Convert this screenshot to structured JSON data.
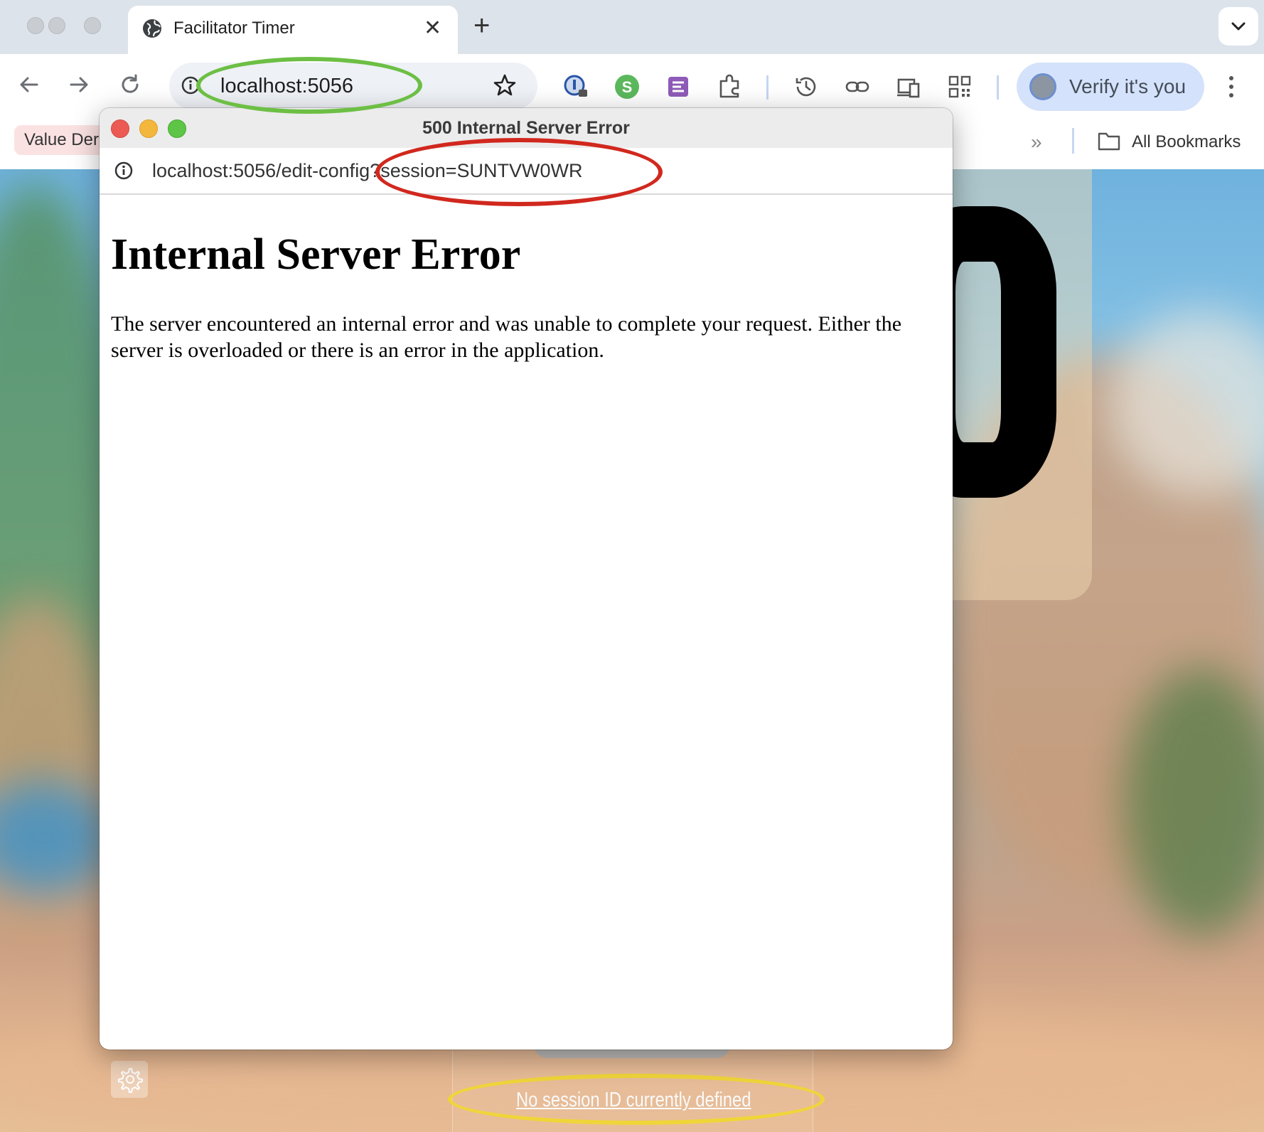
{
  "browser": {
    "tab": {
      "title": "Facilitator Timer"
    },
    "new_tab_symbol": "+",
    "tab_close_symbol": "✕",
    "omnibox": {
      "url": "localhost:5056"
    },
    "profile_button": {
      "label": "Verify it's you"
    },
    "bookmarks": {
      "items": [
        {
          "label": "Value Der"
        }
      ],
      "overflow_symbol": "»",
      "all_bookmarks_label": "All Bookmarks"
    }
  },
  "popup": {
    "window_title": "500 Internal Server Error",
    "url": "localhost:5056/edit-config?session=SUNTVW0WR",
    "heading": "Internal Server Error",
    "message": "The server encountered an internal error and was unable to complete your request. Either the server is overloaded or there is an error in the application."
  },
  "page": {
    "session_status_link": "No session ID currently defined"
  },
  "annotations": {
    "colors": {
      "green": "#6cbf44",
      "red": "#d1281e",
      "yellow": "#f0d53a"
    }
  },
  "icons": [
    "globe-icon",
    "back-arrow-icon",
    "forward-arrow-icon",
    "reload-icon",
    "site-info-icon",
    "star-icon",
    "password-extension-icon",
    "s-extension-icon",
    "jira-extension-icon",
    "puzzle-extensions-icon",
    "history-icon",
    "link-icon",
    "devices-icon",
    "qr-code-icon",
    "kebab-menu-icon",
    "folder-icon",
    "gear-icon",
    "chevron-down-icon"
  ]
}
